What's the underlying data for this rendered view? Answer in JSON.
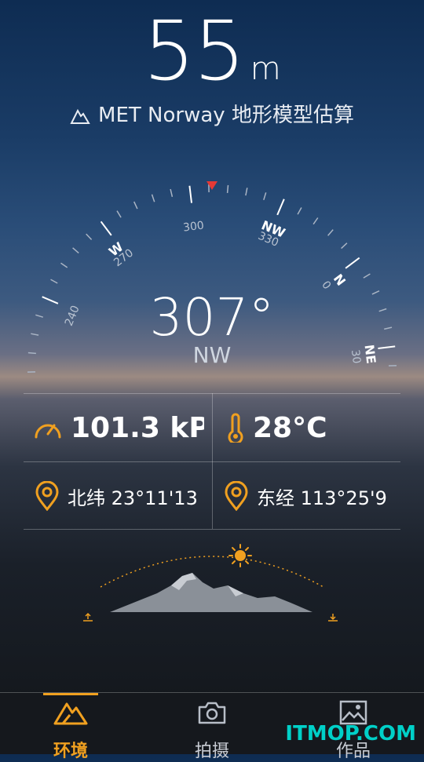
{
  "altitude": {
    "value": "55",
    "unit": "m"
  },
  "source": {
    "text": "MET Norway 地形模型估算"
  },
  "compass": {
    "heading_degrees": "307°",
    "heading_direction": "NW",
    "heading_value": 307,
    "labels": {
      "n240": "240",
      "n270": "270",
      "n300": "300",
      "n330": "330",
      "n0": "0",
      "n30": "30",
      "w": "W",
      "nw": "NW",
      "n": "N",
      "ne": "NE"
    },
    "marker_color": "#e53935"
  },
  "readings": {
    "pressure": "101.3 kP",
    "temperature": "28°C",
    "latitude": "北纬 23°11'13",
    "longitude": "东经 113°25'9"
  },
  "accent_color": "#f0a020",
  "tabs": [
    {
      "label": "环境",
      "icon": "mountain-icon",
      "active": true
    },
    {
      "label": "拍摄",
      "icon": "camera-icon",
      "active": false
    },
    {
      "label": "作品",
      "icon": "picture-icon",
      "active": false
    }
  ],
  "watermark": "ITMOP.COM"
}
